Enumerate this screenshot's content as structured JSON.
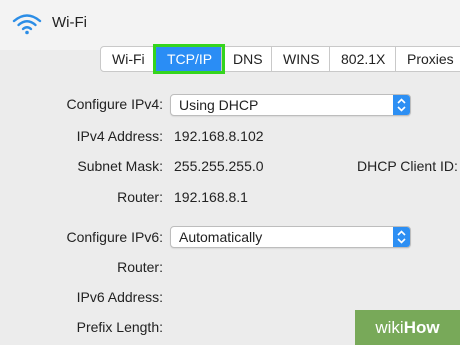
{
  "window": {
    "title": "Wi-Fi",
    "icon": "wifi-icon"
  },
  "tabs": [
    {
      "label": "Wi-Fi",
      "active": false
    },
    {
      "label": "TCP/IP",
      "active": true
    },
    {
      "label": "DNS",
      "active": false
    },
    {
      "label": "WINS",
      "active": false
    },
    {
      "label": "802.1X",
      "active": false
    },
    {
      "label": "Proxies",
      "active": false
    }
  ],
  "ipv4": {
    "configure_label": "Configure IPv4:",
    "configure_value": "Using DHCP",
    "address_label": "IPv4 Address:",
    "address_value": "192.168.8.102",
    "subnet_label": "Subnet Mask:",
    "subnet_value": "255.255.255.0",
    "dhcp_client_id_label": "DHCP Client ID:",
    "router_label": "Router:",
    "router_value": "192.168.8.1"
  },
  "ipv6": {
    "configure_label": "Configure IPv6:",
    "configure_value": "Automatically",
    "router_label": "Router:",
    "address_label": "IPv6 Address:",
    "prefix_label": "Prefix Length:"
  },
  "watermark": {
    "part1": "wiki",
    "part2": "How"
  },
  "colors": {
    "accent": "#2a8df5",
    "highlight": "#35d51d",
    "watermark": "#6ea34c"
  }
}
